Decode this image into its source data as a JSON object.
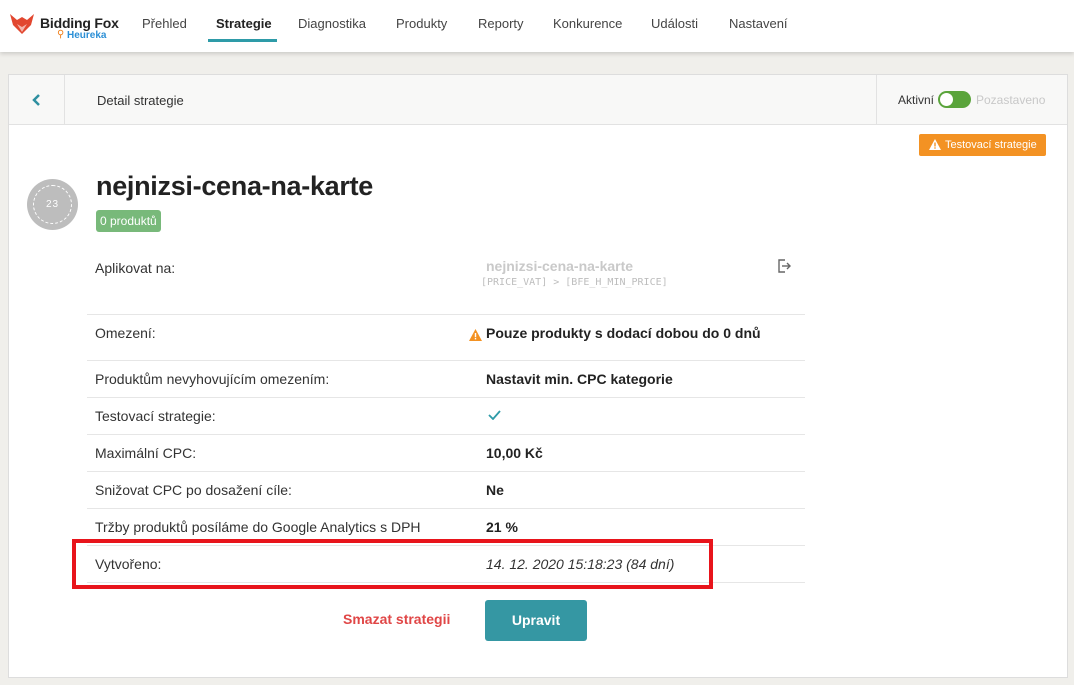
{
  "brand": {
    "name": "Bidding Fox",
    "sub": "Heureka"
  },
  "nav": {
    "items": [
      "Přehled",
      "Strategie",
      "Diagnostika",
      "Produkty",
      "Reporty",
      "Konkurence",
      "Události",
      "Nastavení"
    ],
    "active": "Strategie"
  },
  "header": {
    "title": "Detail strategie",
    "status_active": "Aktivní",
    "status_paused": "Pozastaveno",
    "toggle_on": true
  },
  "badge": {
    "test_strategy": "Testovací strategie"
  },
  "avatar": {
    "text": "23"
  },
  "strategy": {
    "name": "nejnizsi-cena-na-karte",
    "products_badge": "0 produktů"
  },
  "rows": {
    "apply": {
      "label": "Aplikovat na:",
      "name": "nejnizsi-cena-na-karte",
      "code": "[PRICE_VAT] > [BFE_H_MIN_PRICE]"
    },
    "restriction": {
      "label": "Omezení:",
      "value": "Pouze produkty s dodací dobou do 0 dnů"
    },
    "non_matching": {
      "label": "Produktům nevyhovujícím omezením:",
      "value": "Nastavit min. CPC kategorie"
    },
    "testing": {
      "label": "Testovací strategie:",
      "value": true
    },
    "max_cpc": {
      "label": "Maximální CPC:",
      "value": "10,00 Kč"
    },
    "lower_cpc": {
      "label": "Snižovat CPC po dosažení cíle:",
      "value": "Ne"
    },
    "analytics": {
      "label": "Tržby produktů posíláme do Google Analytics s DPH",
      "value": "21 %"
    },
    "created": {
      "label": "Vytvořeno:",
      "value": "14. 12. 2020 15:18:23 (84 dní)"
    }
  },
  "actions": {
    "delete": "Smazat strategii",
    "edit": "Upravit"
  },
  "colors": {
    "accent": "#3597a3",
    "active_toggle": "#5aa43b",
    "warning": "#f39223",
    "danger": "#e04646",
    "highlight": "#e8141b"
  }
}
